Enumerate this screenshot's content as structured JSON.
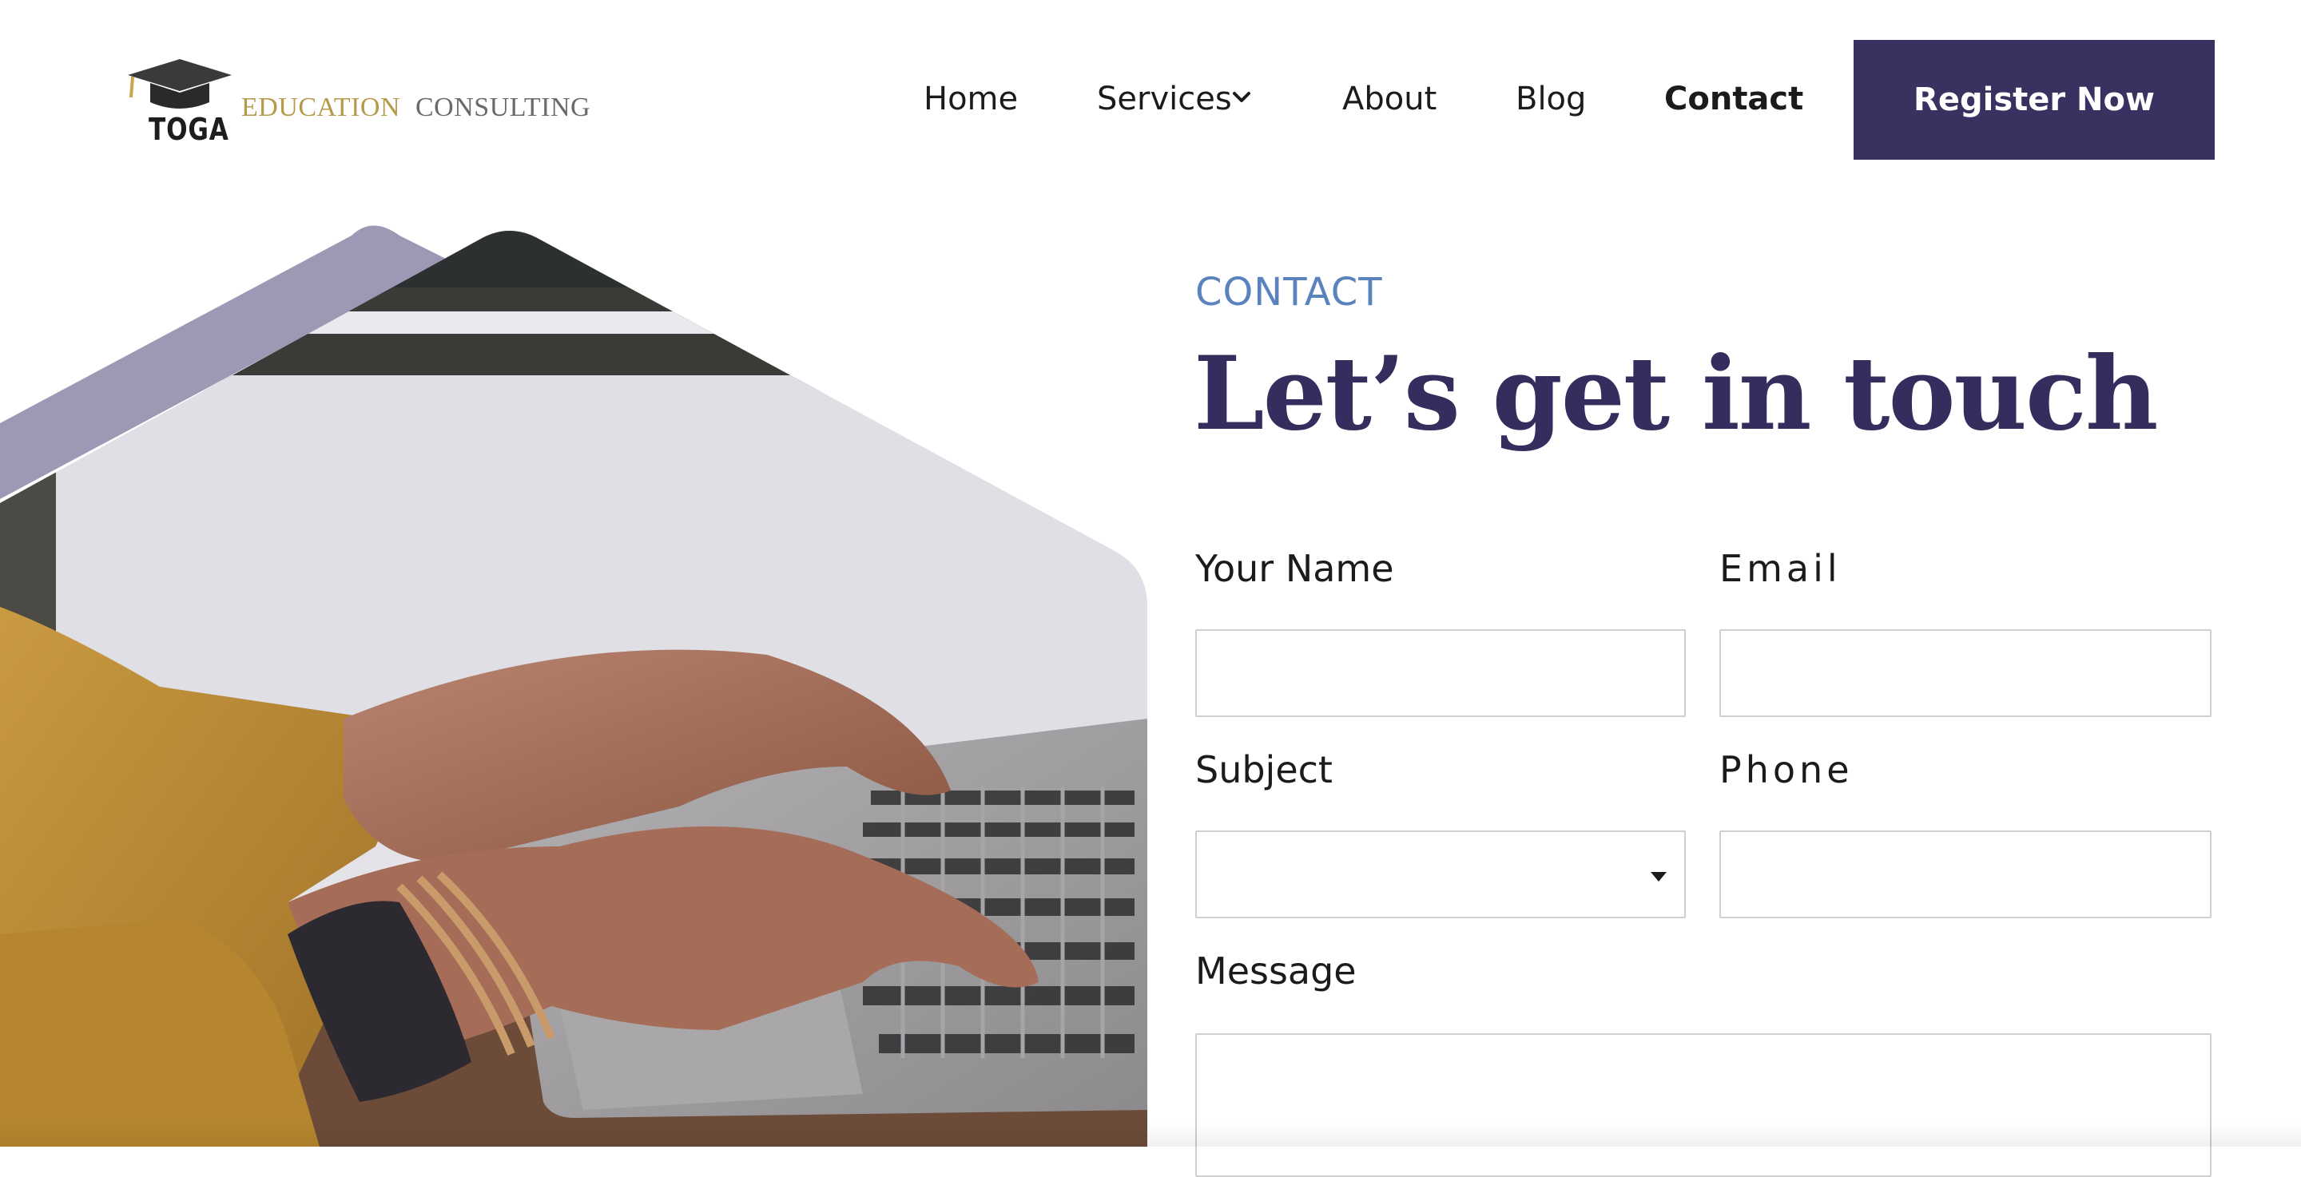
{
  "brand": {
    "name": "TOGA",
    "tagline_part1": "EDUCATION",
    "tagline_part2": "CONSULTING",
    "colors": {
      "primary": "#3a3161",
      "gold": "#b49a4a",
      "accent": "#5a83bd"
    }
  },
  "nav": {
    "items": [
      {
        "label": "Home"
      },
      {
        "label": "Services",
        "icon": "chevron-down-icon"
      },
      {
        "label": "About"
      },
      {
        "label": "Blog"
      },
      {
        "label": "Contact",
        "active": true
      }
    ],
    "cta": "Register Now"
  },
  "hero": {
    "image": "hands typing on laptop keyboard, mustard sweater and bracelets"
  },
  "contact": {
    "eyebrow": "CONTACT",
    "title": "Let’s get in touch",
    "fields": {
      "name": {
        "label": "Your Name",
        "value": ""
      },
      "email": {
        "label": "Email",
        "value": ""
      },
      "subject": {
        "label": "Subject",
        "value": "",
        "icon": "caret-down-icon"
      },
      "phone": {
        "label": "Phone",
        "value": ""
      },
      "message": {
        "label": "Message",
        "value": ""
      }
    }
  }
}
